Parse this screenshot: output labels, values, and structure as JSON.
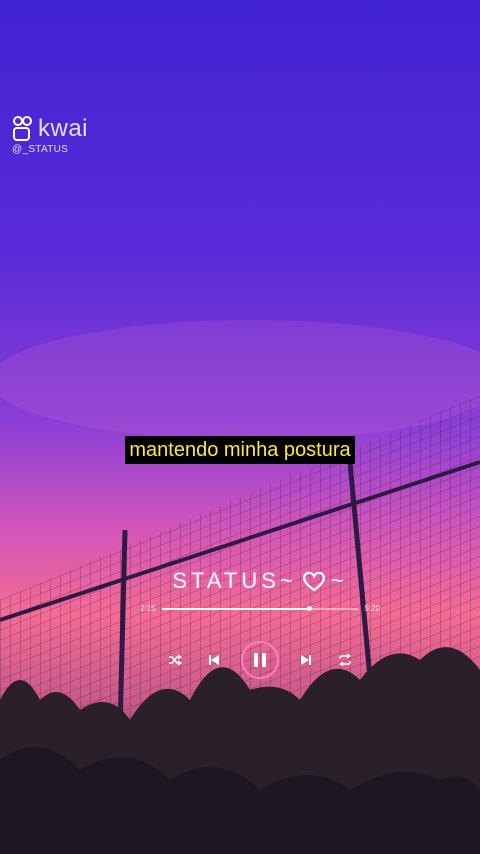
{
  "watermark": {
    "brand": "kwai",
    "handle": "@_STATUS",
    "logo_icon": "kwai-logo-icon"
  },
  "caption": "mantendo minha postura",
  "player": {
    "title": "STATUS~",
    "title_suffix": "~",
    "heart_icon": "heart-outline-icon",
    "time_elapsed": "2:15",
    "time_total": "5:20",
    "progress": 0.75,
    "state": "playing",
    "controls": [
      "shuffle-icon",
      "previous-icon",
      "pause-icon",
      "next-icon",
      "repeat-icon"
    ],
    "accent_color": "#ff7cc4"
  },
  "colors": {
    "sky_top": "#4a25d6",
    "sky_mid": "#8a3bd8",
    "horizon": "#f36a93",
    "caption_text": "#ffe935",
    "caption_bg": "#000000"
  }
}
